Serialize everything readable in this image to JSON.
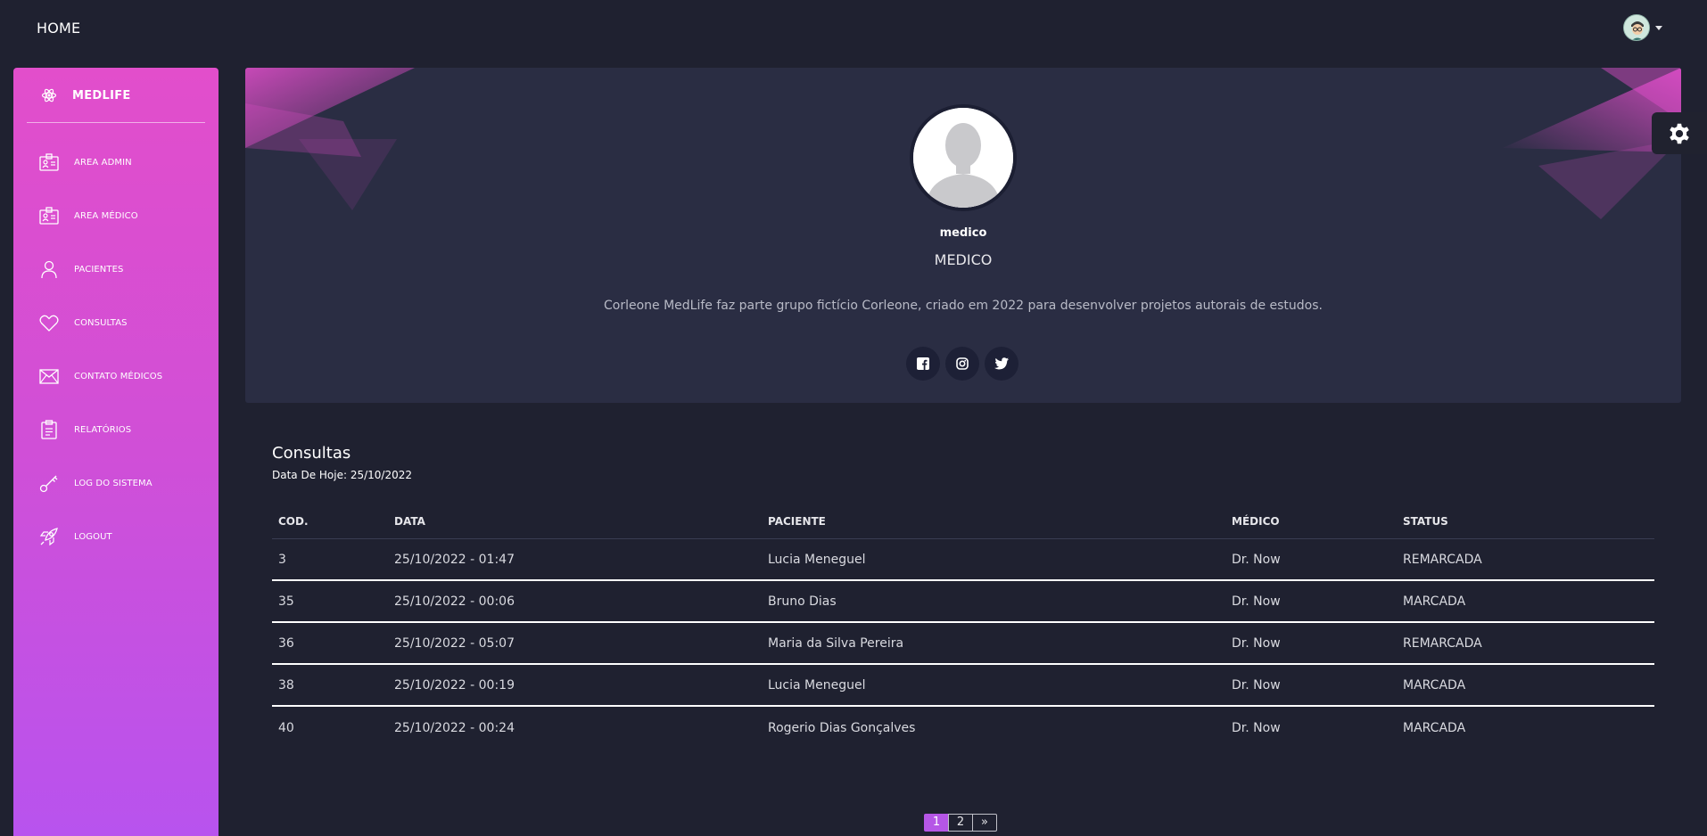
{
  "navbar": {
    "home_label": "HOME"
  },
  "sidebar": {
    "brand": "MEDLIFE",
    "items": [
      {
        "label": "AREA ADMIN",
        "icon": "id-card-icon"
      },
      {
        "label": "AREA MÉDICO",
        "icon": "id-card-icon"
      },
      {
        "label": "PACIENTES",
        "icon": "user-icon"
      },
      {
        "label": "CONSULTAS",
        "icon": "heart-icon"
      },
      {
        "label": "CONTATO MÉDICOS",
        "icon": "envelope-icon"
      },
      {
        "label": "RELATÓRIOS",
        "icon": "clipboard-icon"
      },
      {
        "label": "LOG DO SISTEMA",
        "icon": "key-icon"
      },
      {
        "label": "LOGOUT",
        "icon": "rocket-icon"
      }
    ]
  },
  "profile": {
    "username": "medico",
    "role": "MEDICO",
    "description": "Corleone MedLife faz parte grupo fictício Corleone, criado em 2022 para desenvolver projetos autorais de estudos.",
    "social": [
      "facebook-icon",
      "instagram-icon",
      "twitter-icon"
    ]
  },
  "consultas": {
    "title": "Consultas",
    "subtitle": "Data De Hoje: 25/10/2022",
    "columns": [
      "COD.",
      "DATA",
      "PACIENTE",
      "MÉDICO",
      "STATUS"
    ],
    "rows": [
      {
        "cod": "3",
        "data": "25/10/2022 - 01:47",
        "paciente": "Lucia Meneguel",
        "medico": "Dr. Now",
        "status": "REMARCADA"
      },
      {
        "cod": "35",
        "data": "25/10/2022 - 00:06",
        "paciente": "Bruno Dias",
        "medico": "Dr. Now",
        "status": "MARCADA"
      },
      {
        "cod": "36",
        "data": "25/10/2022 - 05:07",
        "paciente": "Maria da Silva Pereira",
        "medico": "Dr. Now",
        "status": "REMARCADA"
      },
      {
        "cod": "38",
        "data": "25/10/2022 - 00:19",
        "paciente": "Lucia Meneguel",
        "medico": "Dr. Now",
        "status": "MARCADA"
      },
      {
        "cod": "40",
        "data": "25/10/2022 - 00:24",
        "paciente": "Rogerio Dias Gonçalves",
        "medico": "Dr. Now",
        "status": "MARCADA"
      }
    ]
  },
  "pagination": {
    "pages": [
      "1",
      "2",
      "»"
    ],
    "active": "1"
  },
  "colors": {
    "background": "#1f2130",
    "card": "#2a2d43",
    "sidebar_top": "#e24ecb",
    "sidebar_bottom": "#b853ee",
    "accent": "#b556e6"
  }
}
